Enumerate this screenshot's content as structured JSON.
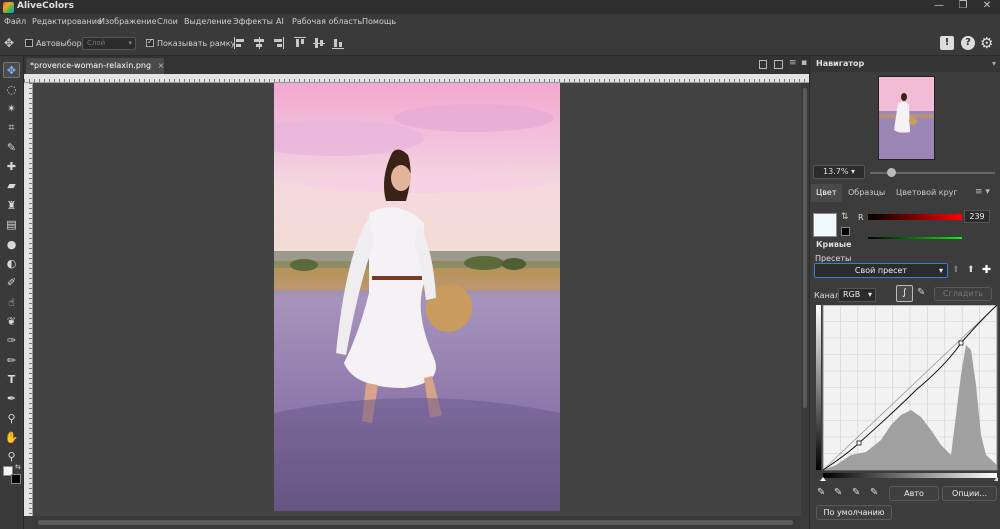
{
  "app": {
    "title": "AliveColors"
  },
  "window_controls": {
    "minimize": "—",
    "maximize": "❐",
    "close": "✕"
  },
  "menu": [
    "Файл",
    "Редактирование",
    "Изображение",
    "Слои",
    "Выделение",
    "Эффекты",
    "AI",
    "Рабочая область",
    "Помощь"
  ],
  "options": {
    "autoselect_label": "Автовыбор",
    "autoselect_checked": false,
    "layer_combo": "Слой",
    "show_frame_label": "Показывать рамку",
    "show_frame_checked": true,
    "right_icons": [
      "!",
      "?",
      "⚙"
    ]
  },
  "document": {
    "tab_title": "*provence-woman-relaxin.png",
    "tab_close": "×"
  },
  "navigator": {
    "title": "Навигатор",
    "zoom": "13.7%"
  },
  "color_panel": {
    "tabs": [
      "Цвет",
      "Образцы",
      "Цветовой круг"
    ],
    "channel_r_label": "R",
    "r_value": "239",
    "g_value": "249",
    "g_value_fraction": 0.98
  },
  "curves": {
    "title": "Кривые",
    "presets_label": "Пресеты",
    "preset_value": "Свой пресет",
    "channel_label": "Канал",
    "channel_value": "RGB",
    "smooth_button": "Сгладить",
    "auto_button": "Авто",
    "options_button": "Опции...",
    "default_button": "По умолчанию"
  },
  "colors": {
    "accent": "#3f7bd1",
    "panel_bg": "#3c3c3c",
    "dark_bg": "#2f2f2f"
  }
}
